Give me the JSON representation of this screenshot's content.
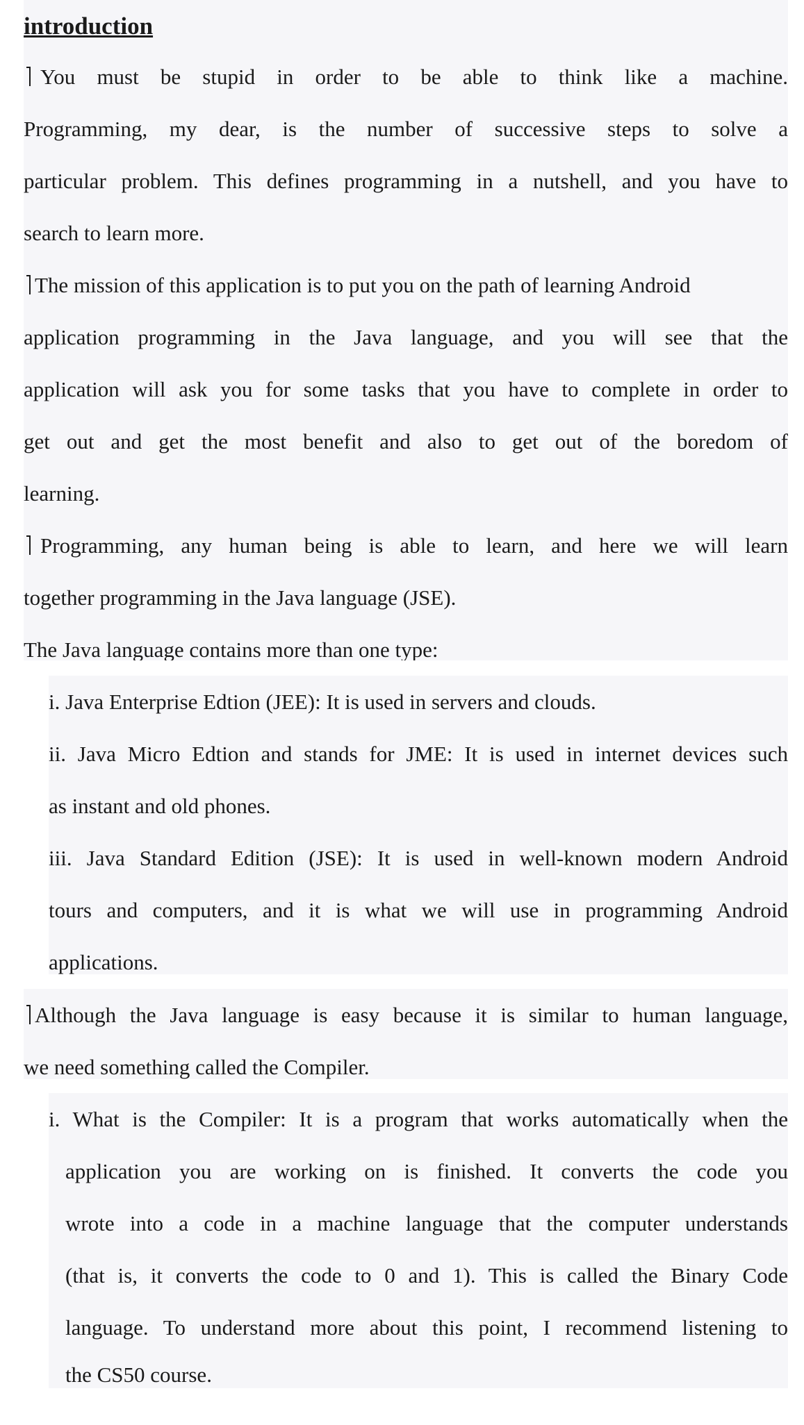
{
  "document": {
    "heading": "introduction",
    "bullet_symbol": "bracket-bullet-icon",
    "paragraph1": {
      "lines": [
        "You must be stupid in order to be able to think like a machine.",
        "Programming, my dear, is the number of successive steps to solve a",
        "particular problem. This defines programming in a nutshell, and you have to",
        "search to learn more."
      ]
    },
    "paragraph2": {
      "lines": [
        "The mission of this application is to put you on the path of learning Android",
        "application programming in the Java language, and you will see that the",
        "application will ask you for some tasks that you have to complete in order to",
        "get out and get the most benefit and also to get out of the boredom of",
        "learning."
      ]
    },
    "paragraph3": {
      "lines": [
        "Programming, any human being is able to learn, and here we will learn",
        "together programming in the Java language (JSE)."
      ]
    },
    "types_intro": "The Java language contains more than one type:",
    "types_list": {
      "item1": [
        "i. Java Enterprise Edtion (JEE): It is used in servers and clouds."
      ],
      "item2": [
        "ii. Java Micro Edtion and stands for JME: It is used in internet devices such",
        "as instant and old phones."
      ],
      "item3": [
        "iii. Java Standard Edition (JSE): It is used in well-known modern Android",
        "tours and computers, and it is what we will use in programming Android",
        "applications."
      ]
    },
    "paragraph4": {
      "lines": [
        "Although the Java language is easy because it is similar to human language,",
        "we need something called the Compiler."
      ]
    },
    "compiler_list": {
      "item1": [
        "i. What is the Compiler: It is a program that works automatically when the",
        "application you are working on is finished. It converts the code you",
        "wrote into a code in a machine language that the computer understands",
        "(that is, it converts the code to 0 and 1). This is called the Binary Code",
        "language. To understand more about this point, I recommend listening to",
        "the CS50 course."
      ]
    }
  }
}
